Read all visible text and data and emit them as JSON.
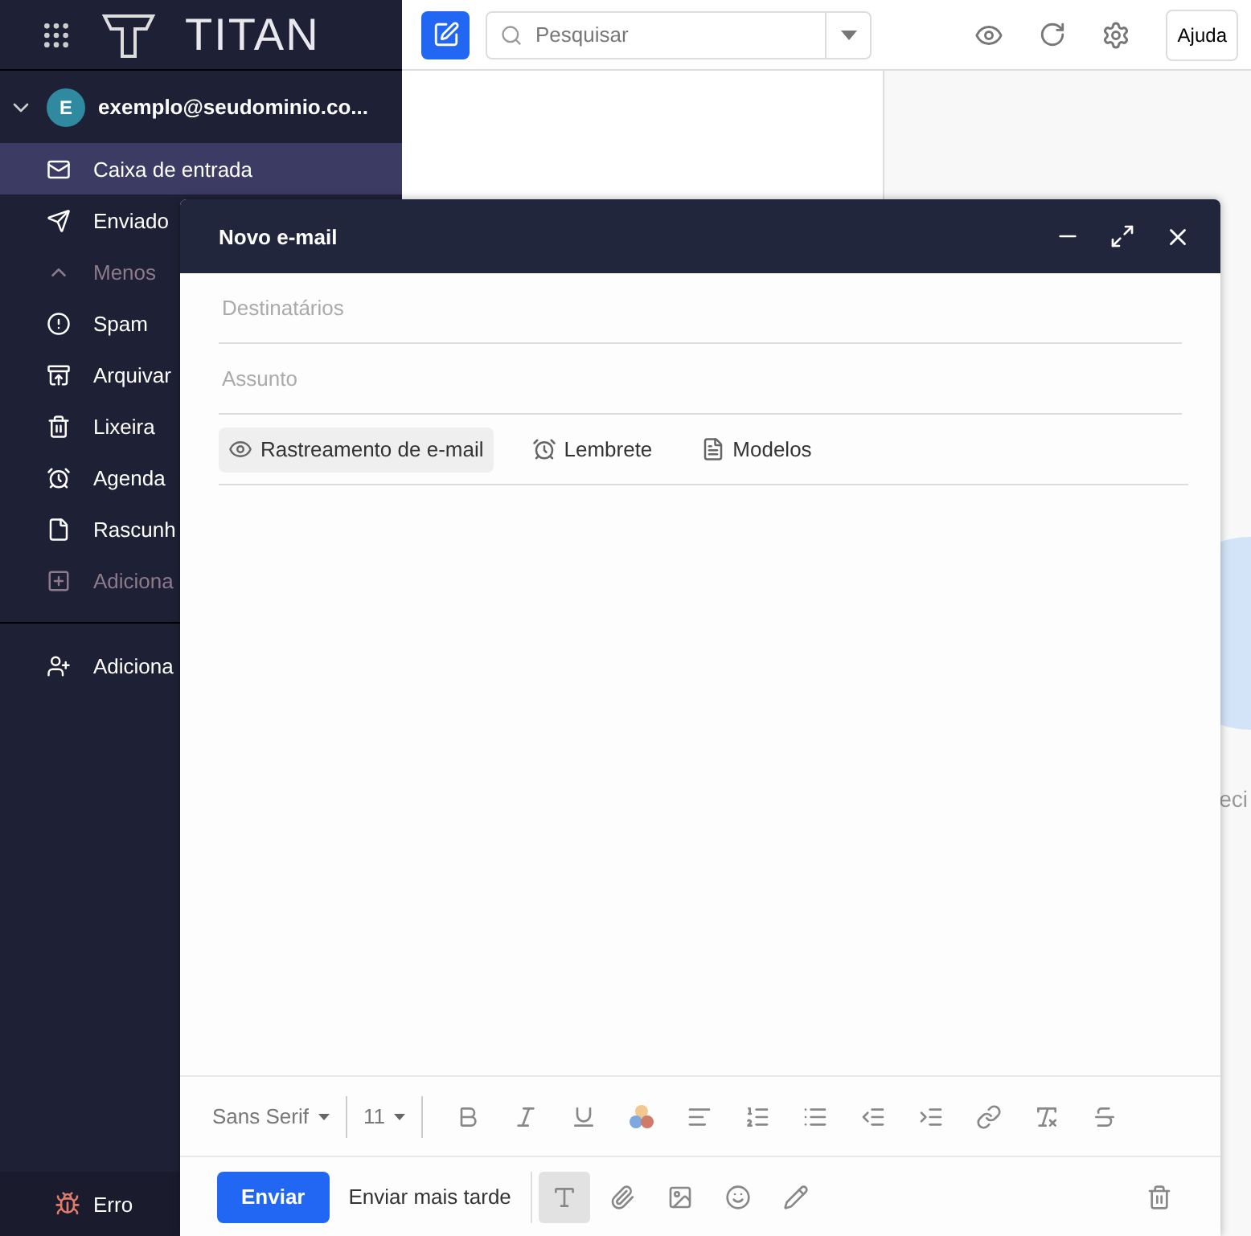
{
  "app": {
    "logo": "TITAN"
  },
  "search": {
    "placeholder": "Pesquisar"
  },
  "help_button": "Ajuda",
  "account": {
    "avatar": "E",
    "email": "exemplo@seudominio.co...",
    "expanded": true
  },
  "folders": [
    {
      "label": "Caixa de entrada",
      "kind": "mail",
      "selected": true,
      "disabled": false
    },
    {
      "label": "Enviado",
      "kind": "send",
      "selected": false,
      "disabled": false
    },
    {
      "label": "Menos",
      "kind": "chevron",
      "selected": false,
      "disabled": true
    },
    {
      "label": "Spam",
      "kind": "alert",
      "selected": false,
      "disabled": false
    },
    {
      "label": "Arquivar",
      "kind": "archive",
      "selected": false,
      "disabled": false
    },
    {
      "label": "Lixeira",
      "kind": "trash",
      "selected": false,
      "disabled": false
    },
    {
      "label": "Agenda",
      "kind": "clock",
      "selected": false,
      "disabled": false
    },
    {
      "label": "Rascunh",
      "kind": "draft",
      "selected": false,
      "disabled": false
    },
    {
      "label": "Adiciona",
      "kind": "plus",
      "selected": false,
      "disabled": true
    }
  ],
  "add_account": "Adiciona",
  "status": "Erro",
  "compose": {
    "title": "Novo e-mail",
    "recipients_placeholder": "Destinatários",
    "subject_placeholder": "Assunto",
    "tools": [
      {
        "label": "Rastreamento de e-mail",
        "kind": "eye",
        "selected": true
      },
      {
        "label": "Lembrete",
        "kind": "alarm",
        "selected": false
      },
      {
        "label": "Modelos",
        "kind": "template",
        "selected": false
      }
    ],
    "font": "Sans Serif",
    "size": "11",
    "formatting_on": true,
    "send": "Enviar",
    "send_later": "Enviar mais tarde"
  },
  "reading_pane": {
    "hint": "eci"
  }
}
